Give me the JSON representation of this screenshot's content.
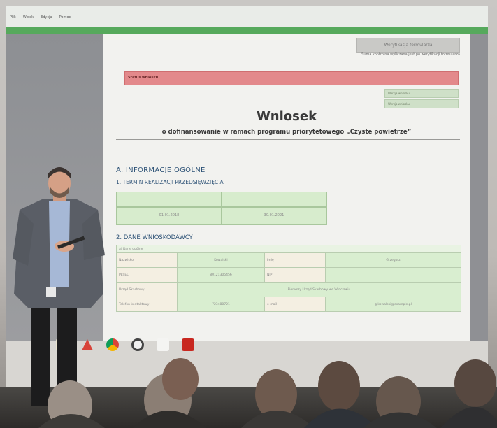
{
  "window": {
    "title": "",
    "menu": [
      "Plik",
      "Widok",
      "Edycja",
      "Pomoc"
    ]
  },
  "document": {
    "verify_button": "Weryfikacja formularza",
    "verify_note": "Suma kontrolna wyliczana jest po weryfikacji formularza",
    "alert_label": "Status wniosku",
    "meta_lines": [
      "Wersja wniosku",
      "Wersja wniosku"
    ],
    "title": "Wniosek",
    "subtitle": "o dofinansowanie w ramach programu priorytetowego „Czyste powietrze”",
    "section_a": "A. INFORMACJE OGÓLNE",
    "section_1": "1. TERMIN REALIZACJI PRZEDSIĘWZIĘCIA",
    "section_2": "2. DANE WNIOSKODAWCY",
    "dates": [
      "01.01.2018",
      "30.01.2021"
    ],
    "table_header": "a) Dane ogólne",
    "table_rows": [
      {
        "label": "Nazwisko",
        "value": "Kowalski",
        "label2": "Imię",
        "value2": "Grzegorz"
      },
      {
        "label": "PESEL",
        "value": "80121305456",
        "label2": "NIP",
        "value2": ""
      },
      {
        "label": "Urząd Skarbowy",
        "value": "Pierwszy Urząd Skarbowy we Wrocławiu",
        "label2": "",
        "value2": ""
      },
      {
        "label": "Telefon kontaktowy",
        "value": "723480721",
        "label2": "e-mail",
        "value2": "g.kowalski@example.pl"
      }
    ]
  },
  "colors": {
    "header_green": "#56a95c",
    "field_green": "#d7eccd",
    "alert_red": "#e3898b",
    "heading_blue": "#2d5276"
  },
  "taskbar_icons": [
    "file-icon",
    "warning-icon",
    "chrome-icon",
    "settings-icon",
    "document-icon",
    "pdf-icon"
  ]
}
